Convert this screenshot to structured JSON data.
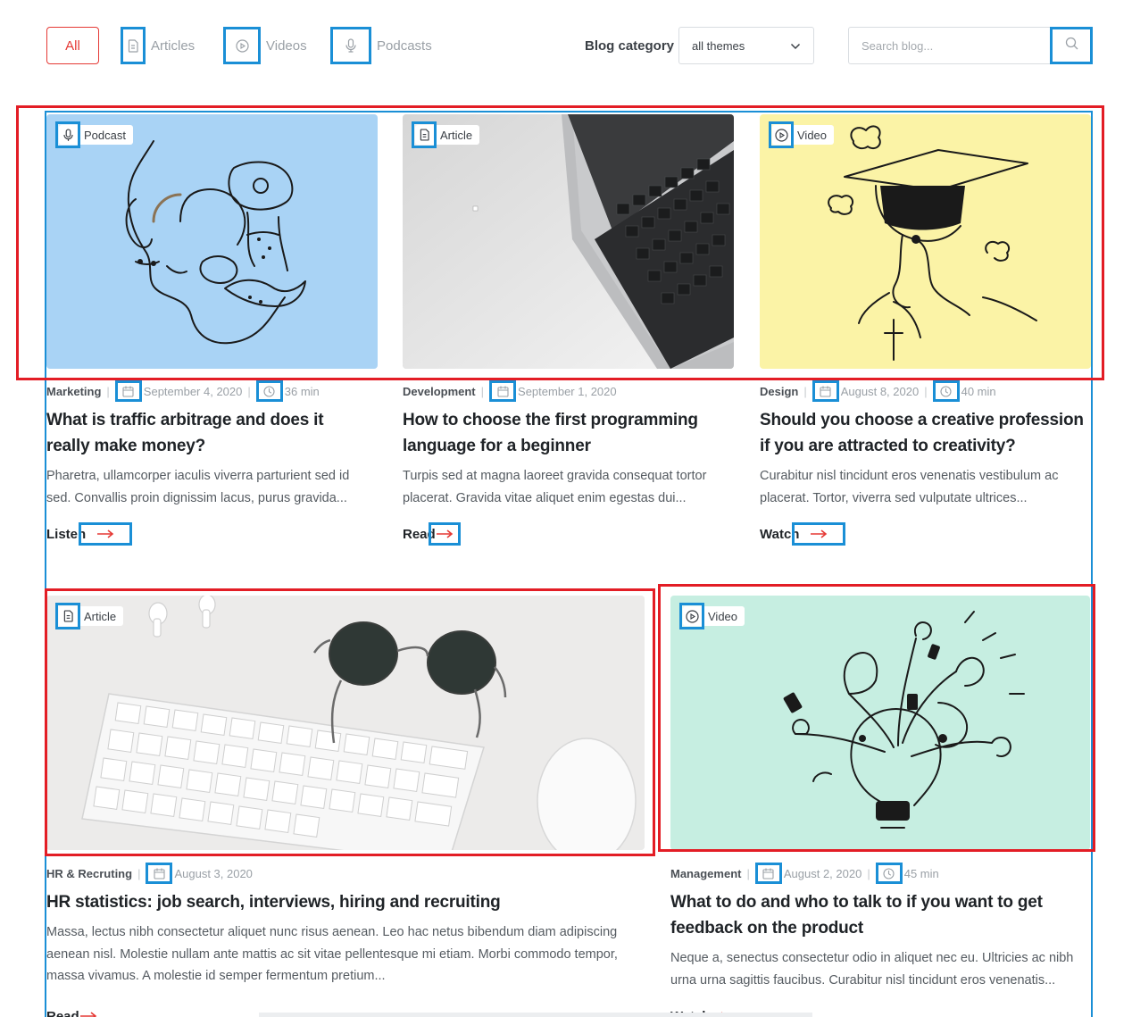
{
  "filters": {
    "all_label": "All",
    "articles_label": "Articles",
    "videos_label": "Videos",
    "podcasts_label": "Podcasts",
    "category_label": "Blog category",
    "category_value": "all themes",
    "search_placeholder": "Search blog..."
  },
  "cards": [
    {
      "type": "Podcast",
      "category": "Marketing",
      "date": "September 4, 2020",
      "duration": "36 min",
      "title": "What is traffic arbitrage and does it really make money?",
      "excerpt": "Pharetra, ullamcorper iaculis viverra parturient sed id sed. Convallis proin dignissim lacus, purus gravida...",
      "cta": "Listen",
      "image_bg": "#a9d3f5"
    },
    {
      "type": "Article",
      "category": "Development",
      "date": "September 1, 2020",
      "title": "How to choose the first programming language for a beginner",
      "excerpt": "Turpis sed at magna laoreet gravida consequat tortor placerat. Gravida vitae aliquet enim egestas dui...",
      "cta": "Read",
      "image_bg": "#d9d9d9"
    },
    {
      "type": "Video",
      "category": "Design",
      "date": "August 8, 2020",
      "duration": "40 min",
      "title": "Should you choose a creative profession if you are attracted to creativity?",
      "excerpt": "Curabitur nisl tincidunt eros venenatis vestibulum ac placerat. Tortor, viverra sed vulputate ultrices...",
      "cta": "Watch",
      "image_bg": "#fbf3a6"
    },
    {
      "type": "Article",
      "category": "HR & Recruting",
      "date": "August 3, 2020",
      "title": "HR statistics: job search,  interviews, hiring and recruiting",
      "excerpt": "Massa, lectus nibh consectetur aliquet nunc risus aenean. Leo hac netus bibendum diam adipiscing aenean nisl. Molestie nullam ante mattis ac sit vitae pellentesque mi etiam. Morbi commodo tempor, massa vivamus. A molestie id semper fermentum pretium...",
      "cta": "Read",
      "image_bg": "#ecebea"
    },
    {
      "type": "Video",
      "category": "Management",
      "date": "August 2, 2020",
      "duration": "45 min",
      "title": "What to do and who to talk to if you want to get feedback on the product",
      "excerpt": "Neque a, senectus consectetur odio in aliquet nec eu. Ultricies ac nibh urna urna sagittis faucibus. Curabitur nisl tincidunt eros venenatis...",
      "cta": "Watch",
      "image_bg": "#c6eee1"
    }
  ],
  "colors": {
    "accent_red": "#e53935",
    "annotation_blue": "#1a8fd6",
    "annotation_red": "#e31d25"
  },
  "icons": {
    "article": "document-icon",
    "video": "play-circle-icon",
    "podcast": "microphone-icon",
    "date": "calendar-icon",
    "duration": "clock-icon",
    "cta": "arrow-right-icon",
    "search": "search-icon",
    "select": "chevron-down-icon"
  }
}
